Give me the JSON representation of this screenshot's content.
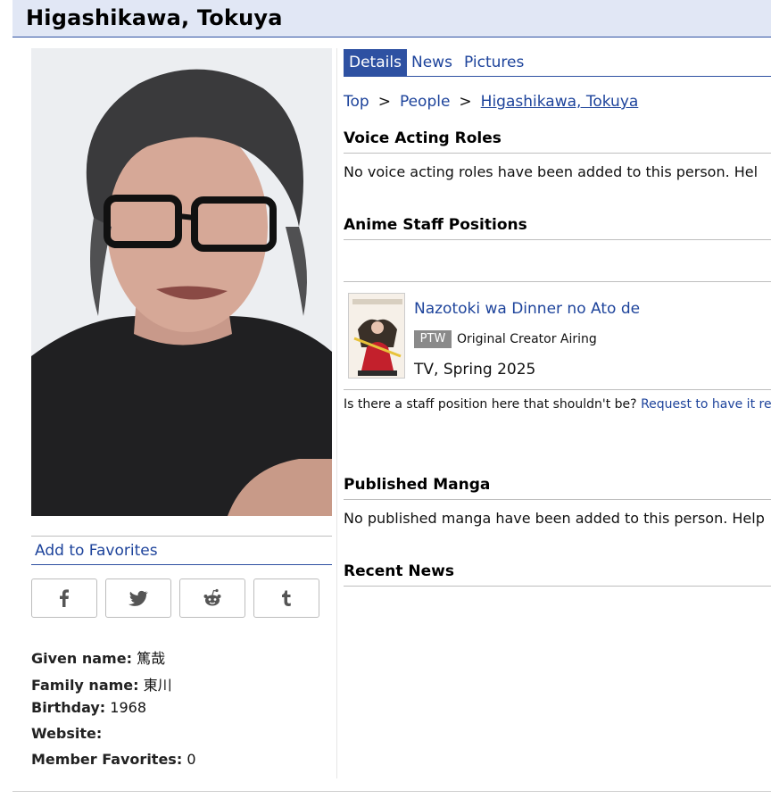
{
  "header": {
    "title": "Higashikawa, Tokuya"
  },
  "sidebar": {
    "add_favorites": "Add to Favorites",
    "share": [
      {
        "icon": "facebook-icon"
      },
      {
        "icon": "twitter-icon"
      },
      {
        "icon": "reddit-icon"
      },
      {
        "icon": "tumblr-icon"
      }
    ],
    "info": {
      "given_name_label": "Given name:",
      "given_name_value": "篤哉",
      "family_name_label": "Family name:",
      "family_name_value": "東川",
      "birthday_label": "Birthday:",
      "birthday_value": "1968",
      "website_label": "Website:",
      "website_value": "",
      "member_favorites_label": "Member Favorites:",
      "member_favorites_value": "0"
    }
  },
  "tabs": [
    {
      "label": "Details",
      "active": true
    },
    {
      "label": "News",
      "active": false
    },
    {
      "label": "Pictures",
      "active": false
    }
  ],
  "breadcrumb": {
    "top": "Top",
    "people": "People",
    "current": "Higashikawa, Tokuya",
    "separator": ">"
  },
  "sections": {
    "voice_acting": {
      "heading": "Voice Acting Roles",
      "text": "No voice acting roles have been added to this person. Hel"
    },
    "anime_staff": {
      "heading": "Anime Staff Positions",
      "entries": [
        {
          "title": "Nazotoki wa Dinner no Ato de",
          "status_badge": "PTW",
          "position": "Original Creator Airing",
          "meta": "TV, Spring 2025"
        }
      ],
      "note": "Is there a staff position here that shouldn't be?",
      "note_link": "Request to have it rer"
    },
    "published_manga": {
      "heading": "Published Manga",
      "text": "No published manga have been added to this person. Help"
    },
    "recent_news": {
      "heading": "Recent News"
    }
  },
  "colors": {
    "accent": "#2e51a2",
    "link": "#1d439b",
    "header_bg": "#e1e7f5",
    "badge": "#8a8a8a"
  }
}
